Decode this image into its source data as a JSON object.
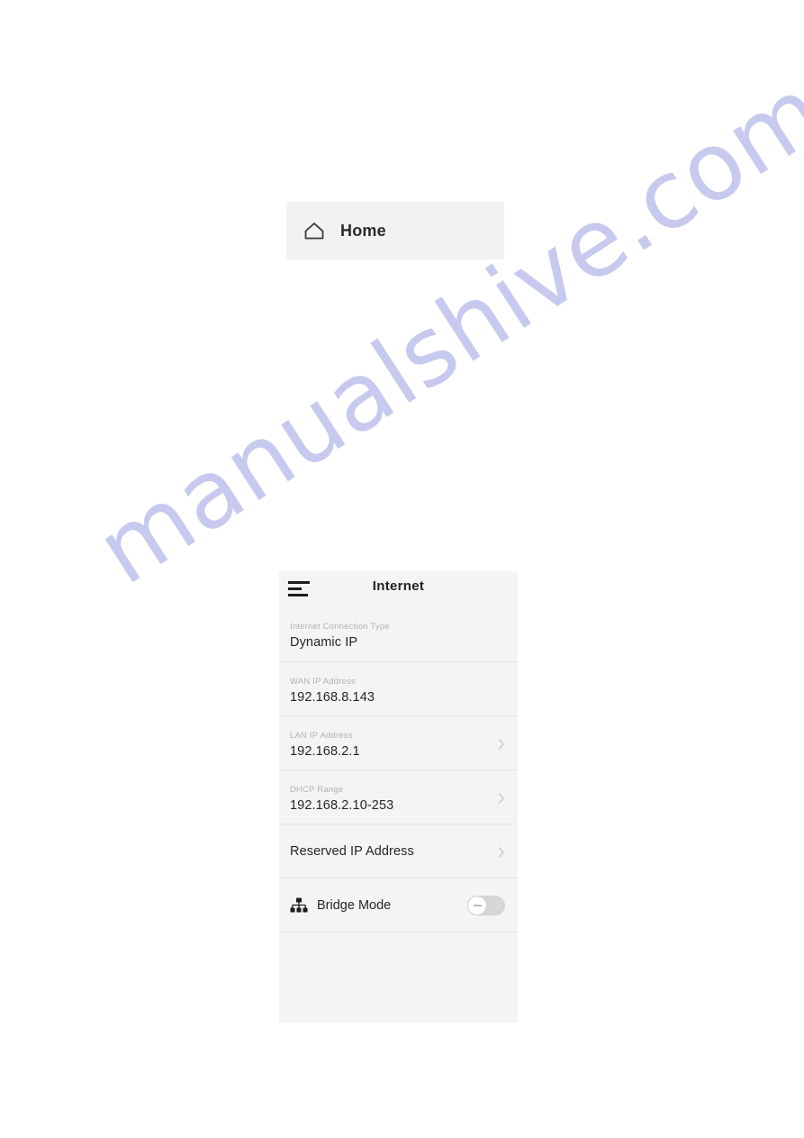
{
  "page": {
    "background": "#ffffff",
    "watermark": "manualshive.com",
    "watermark_color": "#c7caee"
  },
  "home_card": {
    "icon": "home-icon",
    "label": "Home",
    "background": "#f2f2f2"
  },
  "panel": {
    "background": "#f4f4f4",
    "header": {
      "menu_icon": "menu-icon",
      "title": "Internet"
    },
    "rows": [
      {
        "name": "internet-connection-type",
        "label": "Internet Connection Type",
        "value": "Dynamic IP",
        "chevron": false
      },
      {
        "name": "wan-ip-address",
        "label": "WAN IP Address",
        "value": "192.168.8.143",
        "chevron": false
      },
      {
        "name": "lan-ip-address",
        "label": "LAN IP Address",
        "value": "192.168.2.1",
        "chevron": true
      },
      {
        "name": "dhcp-range",
        "label": "DHCP Range",
        "value": "192.168.2.10-253",
        "chevron": true
      },
      {
        "name": "reserved-ip-address",
        "title": "Reserved IP Address",
        "chevron": true
      }
    ],
    "bridge_mode": {
      "icon": "sitemap-icon",
      "label": "Bridge Mode",
      "toggle_state": "off",
      "toggle_track_color": "#d5d6d8",
      "toggle_knob_color": "#ffffff"
    }
  }
}
